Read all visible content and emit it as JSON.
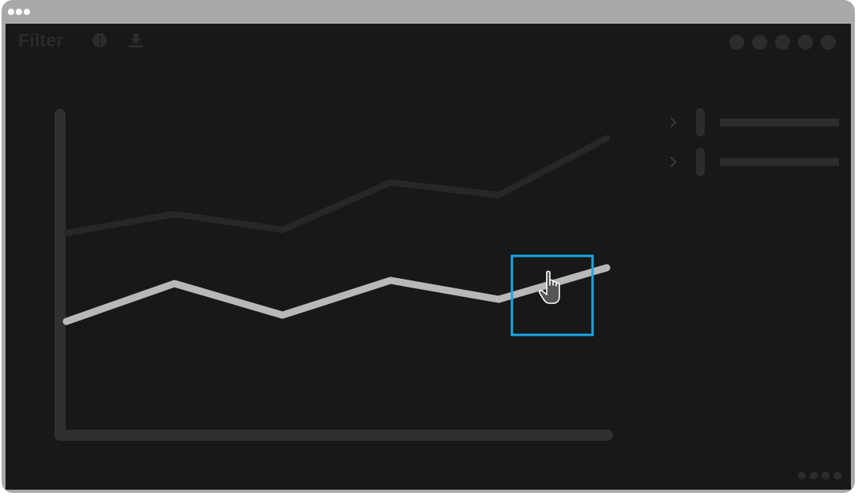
{
  "app": {
    "title": "Filter"
  },
  "toolbar": {
    "icons": [
      "info-icon",
      "download-icon"
    ]
  },
  "window_controls": {
    "count": 5,
    "color": "#2c2c2c"
  },
  "legend": {
    "items": [
      {
        "label": "",
        "expanded": false,
        "series_index": 0
      },
      {
        "label": "",
        "expanded": false,
        "series_index": 1
      }
    ]
  },
  "pagination": {
    "count": 4
  },
  "colors": {
    "frame": "#a9a9ab",
    "background": "#181818",
    "axis": "#303030",
    "series_dark": "#272727",
    "series_light": "#b8b8ba",
    "highlight": "#18a8e4",
    "muted_ui": "#2c2c2c"
  },
  "hover": {
    "series_index": 1,
    "point_index": 5,
    "cursor": "hand-pointer-icon"
  },
  "chart_data": {
    "type": "line",
    "title": "",
    "xlabel": "",
    "ylabel": "",
    "x": [
      0,
      1,
      2,
      3,
      4,
      5
    ],
    "xlim": [
      0,
      5
    ],
    "ylim": [
      0,
      100
    ],
    "grid": false,
    "legend_position": "right",
    "series": [
      {
        "values": [
          55,
          61,
          56,
          71,
          67,
          85
        ],
        "color": "#272727"
      },
      {
        "values": [
          27,
          39,
          29,
          40,
          34,
          44
        ],
        "color": "#b8b8ba"
      }
    ]
  }
}
